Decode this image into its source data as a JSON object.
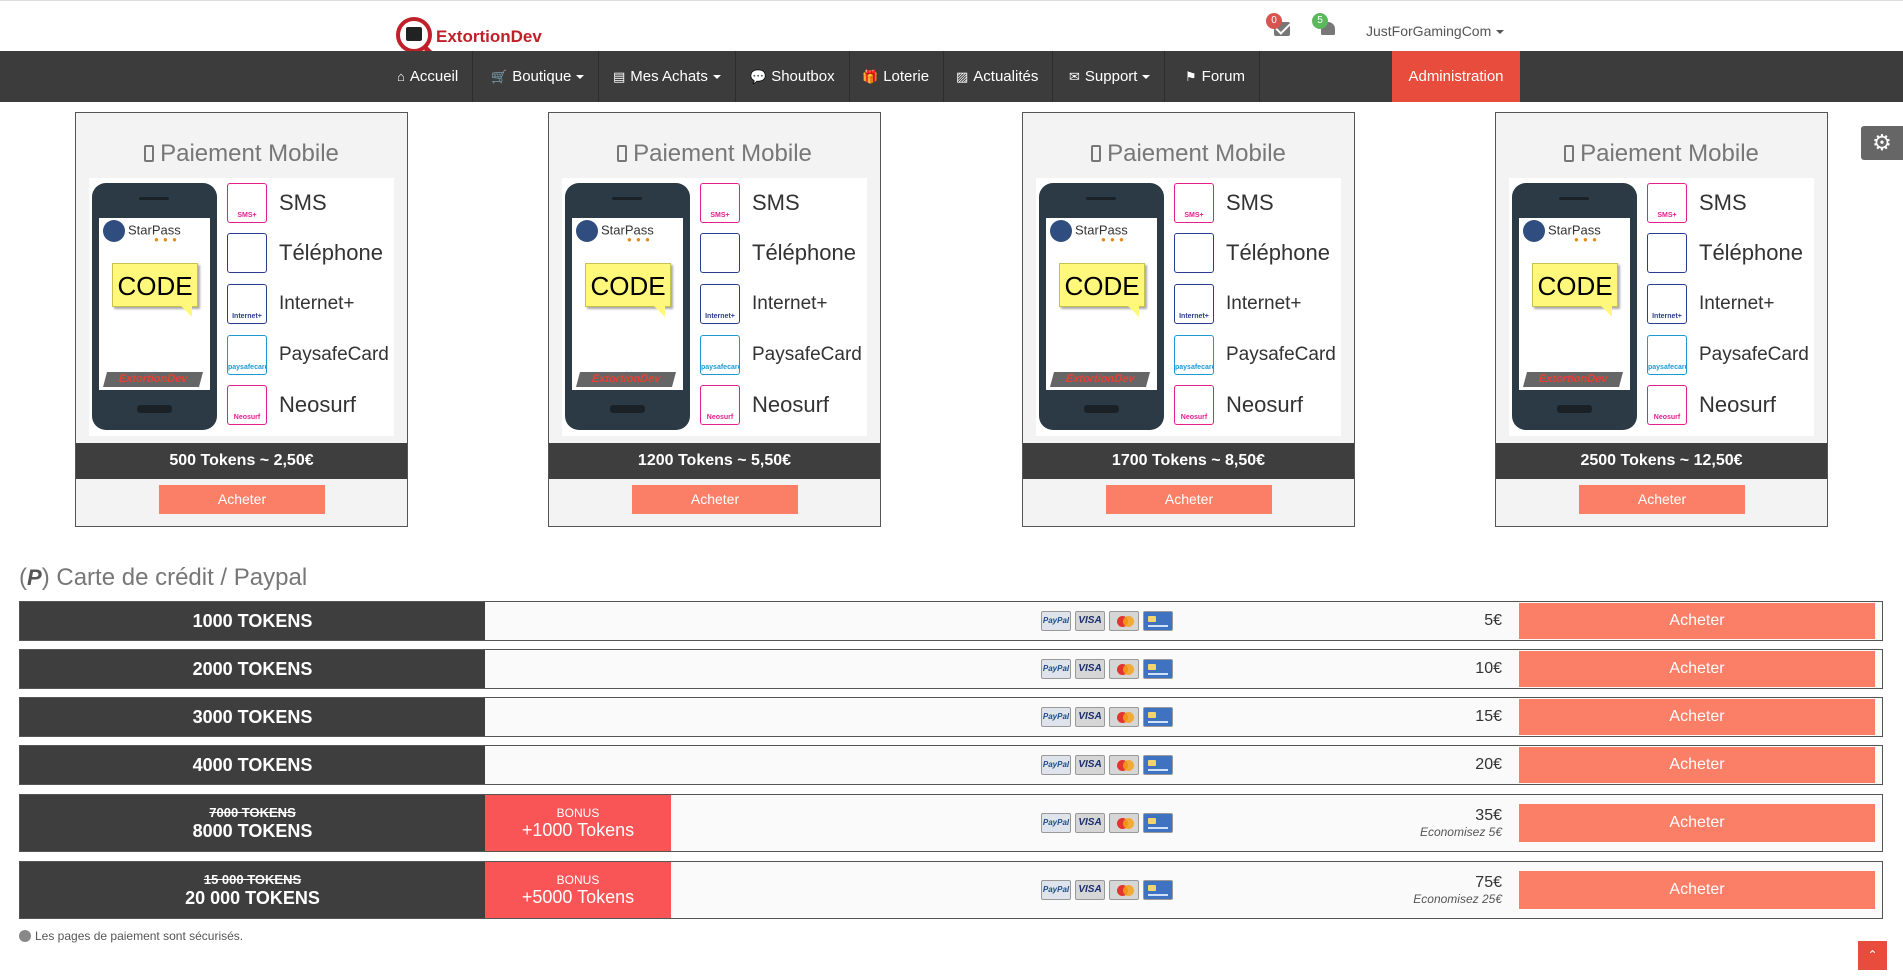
{
  "header": {
    "brand": "ExtortionDev",
    "messages_count": "0",
    "notifications_count": "5",
    "username": "JustForGamingCom"
  },
  "nav": {
    "items": [
      {
        "label": "Accueil",
        "icon": "home-icon"
      },
      {
        "label": "Boutique",
        "icon": "cart-icon",
        "dropdown": true
      },
      {
        "label": "Mes Achats",
        "icon": "book-icon",
        "dropdown": true
      },
      {
        "label": "Shoutbox",
        "icon": "chat-icon"
      },
      {
        "label": "Loterie",
        "icon": "gift-icon"
      },
      {
        "label": "Actualités",
        "icon": "image-icon"
      },
      {
        "label": "Support",
        "icon": "envelope-icon",
        "dropdown": true
      },
      {
        "label": "Forum",
        "icon": "flag-icon"
      }
    ],
    "admin_label": "Administration"
  },
  "mobile": {
    "title": "Paiement Mobile",
    "phone": {
      "provider": "StarPass",
      "code_label": "CODE",
      "tag": "ExtortionDev"
    },
    "methods": [
      {
        "label": "SMS",
        "logo_text": "SMS+"
      },
      {
        "label": "Téléphone",
        "logo_text": ""
      },
      {
        "label": "Internet+",
        "logo_text": "Internet+"
      },
      {
        "label": "PaysafeCard",
        "logo_text": "paysafecard"
      },
      {
        "label": "Neosurf",
        "logo_text": "Neosurf"
      }
    ],
    "buy_label": "Acheter",
    "offers": [
      {
        "price": "500 Tokens ~ 2,50€"
      },
      {
        "price": "1200 Tokens ~ 5,50€"
      },
      {
        "price": "1700 Tokens ~ 8,50€"
      },
      {
        "price": "2500 Tokens ~ 12,50€"
      }
    ]
  },
  "credit": {
    "title": "Carte de crédit / Paypal",
    "buy_label": "Acheter",
    "card_logos": [
      "PayPal",
      "VISA",
      "MasterCard",
      "Card"
    ],
    "rows": [
      {
        "tokens": "1000 TOKENS",
        "old": "",
        "bonus_title": "",
        "bonus": "",
        "amount": "5€",
        "save": ""
      },
      {
        "tokens": "2000 TOKENS",
        "old": "",
        "bonus_title": "",
        "bonus": "",
        "amount": "10€",
        "save": ""
      },
      {
        "tokens": "3000 TOKENS",
        "old": "",
        "bonus_title": "",
        "bonus": "",
        "amount": "15€",
        "save": ""
      },
      {
        "tokens": "4000 TOKENS",
        "old": "",
        "bonus_title": "",
        "bonus": "",
        "amount": "20€",
        "save": ""
      },
      {
        "tokens": "8000 TOKENS",
        "old": "7000 TOKENS",
        "bonus_title": "BONUS",
        "bonus": "+1000 Tokens",
        "amount": "35€",
        "save": "Economisez 5€"
      },
      {
        "tokens": "20 000 TOKENS",
        "old": "15 000 TOKENS",
        "bonus_title": "BONUS",
        "bonus": "+5000 Tokens",
        "amount": "75€",
        "save": "Economisez 25€"
      }
    ],
    "secure_note": "Les pages de paiement sont sécurisés."
  },
  "colors": {
    "accent": "#fa7f66",
    "admin": "#e74c3c",
    "dark": "#3e3e3e",
    "bonus": "#f95456"
  }
}
